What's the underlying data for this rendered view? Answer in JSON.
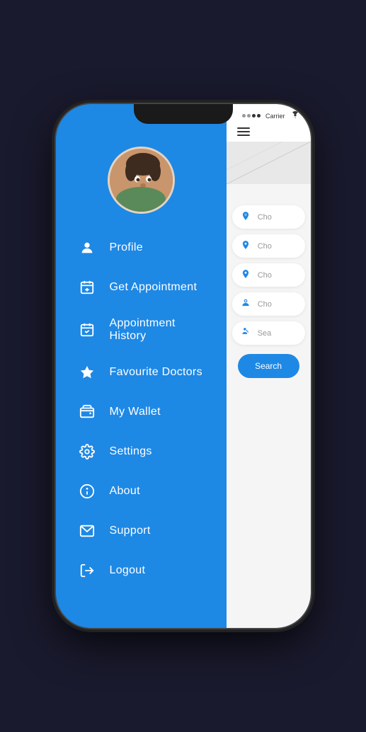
{
  "phone": {
    "status_bar": {
      "carrier": "Carrier",
      "signal_dots": [
        false,
        false,
        true,
        true
      ],
      "wifi": "wifi"
    }
  },
  "sidebar": {
    "menu_items": [
      {
        "id": "profile",
        "label": "Profile",
        "icon": "person"
      },
      {
        "id": "get-appointment",
        "label": "Get Appointment",
        "icon": "calendar-plus"
      },
      {
        "id": "appointment-history",
        "label": "Appointment History",
        "icon": "calendar-check"
      },
      {
        "id": "favourite-doctors",
        "label": "Favourite Doctors",
        "icon": "star"
      },
      {
        "id": "my-wallet",
        "label": "My Wallet",
        "icon": "wallet"
      },
      {
        "id": "settings",
        "label": "Settings",
        "icon": "gear"
      },
      {
        "id": "about",
        "label": "About",
        "icon": "info"
      },
      {
        "id": "support",
        "label": "Support",
        "icon": "envelope"
      },
      {
        "id": "logout",
        "label": "Logout",
        "icon": "logout"
      }
    ]
  },
  "content": {
    "fields": [
      {
        "icon": "location-pin",
        "placeholder": "Cho"
      },
      {
        "icon": "location-pin",
        "placeholder": "Cho"
      },
      {
        "icon": "location-pin",
        "placeholder": "Cho"
      },
      {
        "icon": "person-medical",
        "placeholder": "Cho"
      },
      {
        "icon": "search",
        "placeholder": "Sea"
      }
    ],
    "search_button": "Search"
  }
}
